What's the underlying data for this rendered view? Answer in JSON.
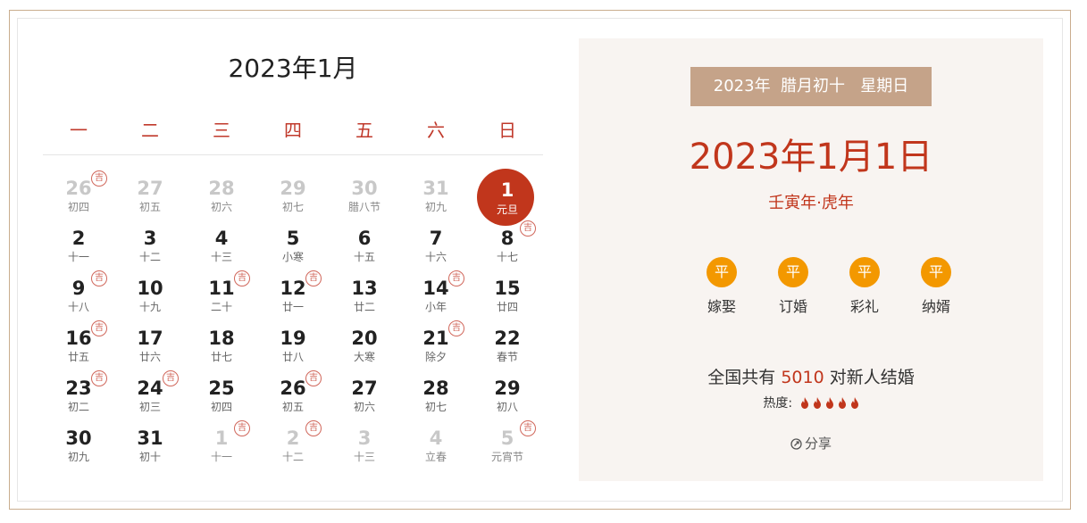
{
  "calendar": {
    "title": "2023年1月",
    "weekdays": [
      "一",
      "二",
      "三",
      "四",
      "五",
      "六",
      "日"
    ],
    "days": [
      {
        "n": "26",
        "l": "初四",
        "other": true,
        "ji": true
      },
      {
        "n": "27",
        "l": "初五",
        "other": true,
        "ji": false
      },
      {
        "n": "28",
        "l": "初六",
        "other": true,
        "ji": false
      },
      {
        "n": "29",
        "l": "初七",
        "other": true,
        "ji": false
      },
      {
        "n": "30",
        "l": "腊八节",
        "other": true,
        "ji": false
      },
      {
        "n": "31",
        "l": "初九",
        "other": true,
        "ji": false
      },
      {
        "n": "1",
        "l": "元旦",
        "other": false,
        "ji": false,
        "selected": true
      },
      {
        "n": "2",
        "l": "十一",
        "other": false,
        "ji": false
      },
      {
        "n": "3",
        "l": "十二",
        "other": false,
        "ji": false
      },
      {
        "n": "4",
        "l": "十三",
        "other": false,
        "ji": false
      },
      {
        "n": "5",
        "l": "小寒",
        "other": false,
        "ji": false
      },
      {
        "n": "6",
        "l": "十五",
        "other": false,
        "ji": false
      },
      {
        "n": "7",
        "l": "十六",
        "other": false,
        "ji": false
      },
      {
        "n": "8",
        "l": "十七",
        "other": false,
        "ji": true
      },
      {
        "n": "9",
        "l": "十八",
        "other": false,
        "ji": true
      },
      {
        "n": "10",
        "l": "十九",
        "other": false,
        "ji": false
      },
      {
        "n": "11",
        "l": "二十",
        "other": false,
        "ji": true
      },
      {
        "n": "12",
        "l": "廿一",
        "other": false,
        "ji": true
      },
      {
        "n": "13",
        "l": "廿二",
        "other": false,
        "ji": false
      },
      {
        "n": "14",
        "l": "小年",
        "other": false,
        "ji": true
      },
      {
        "n": "15",
        "l": "廿四",
        "other": false,
        "ji": false
      },
      {
        "n": "16",
        "l": "廿五",
        "other": false,
        "ji": true
      },
      {
        "n": "17",
        "l": "廿六",
        "other": false,
        "ji": false
      },
      {
        "n": "18",
        "l": "廿七",
        "other": false,
        "ji": false
      },
      {
        "n": "19",
        "l": "廿八",
        "other": false,
        "ji": false
      },
      {
        "n": "20",
        "l": "大寒",
        "other": false,
        "ji": false
      },
      {
        "n": "21",
        "l": "除夕",
        "other": false,
        "ji": true
      },
      {
        "n": "22",
        "l": "春节",
        "other": false,
        "ji": false
      },
      {
        "n": "23",
        "l": "初二",
        "other": false,
        "ji": true
      },
      {
        "n": "24",
        "l": "初三",
        "other": false,
        "ji": true
      },
      {
        "n": "25",
        "l": "初四",
        "other": false,
        "ji": false
      },
      {
        "n": "26",
        "l": "初五",
        "other": false,
        "ji": true
      },
      {
        "n": "27",
        "l": "初六",
        "other": false,
        "ji": false
      },
      {
        "n": "28",
        "l": "初七",
        "other": false,
        "ji": false
      },
      {
        "n": "29",
        "l": "初八",
        "other": false,
        "ji": false
      },
      {
        "n": "30",
        "l": "初九",
        "other": false,
        "ji": false
      },
      {
        "n": "31",
        "l": "初十",
        "other": false,
        "ji": false
      },
      {
        "n": "1",
        "l": "十一",
        "other": true,
        "ji": true
      },
      {
        "n": "2",
        "l": "十二",
        "other": true,
        "ji": true
      },
      {
        "n": "3",
        "l": "十三",
        "other": true,
        "ji": false
      },
      {
        "n": "4",
        "l": "立春",
        "other": true,
        "ji": false
      },
      {
        "n": "5",
        "l": "元宵节",
        "other": true,
        "ji": true
      }
    ],
    "ji_label": "吉"
  },
  "panel": {
    "lunar_line": "2023年  腊月初十   星期日",
    "big_date": "2023年1月1日",
    "ganzhi": "壬寅年·虎年",
    "items": [
      {
        "badge": "平",
        "label": "嫁娶"
      },
      {
        "badge": "平",
        "label": "订婚"
      },
      {
        "badge": "平",
        "label": "彩礼"
      },
      {
        "badge": "平",
        "label": "纳婿"
      }
    ],
    "count_prefix": "全国共有 ",
    "count_value": "5010",
    "count_suffix": " 对新人结婚",
    "heat_label": "热度:",
    "heat_level": 5,
    "share_label": "分享",
    "colors": {
      "accent": "#c1361c",
      "badge": "#f39800",
      "bar": "#c5a389"
    }
  }
}
